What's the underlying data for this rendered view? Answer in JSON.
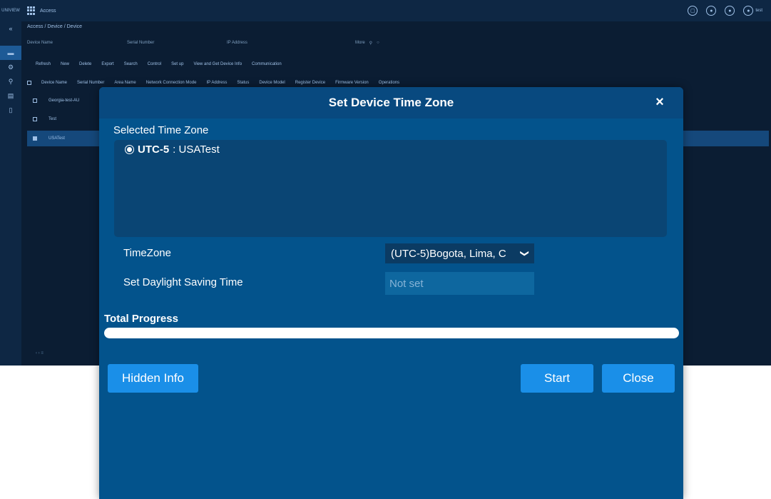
{
  "app": {
    "logo": "UNIVIEW",
    "module": "Access",
    "breadcrumb": "Access / Device / Device",
    "user": "test"
  },
  "filters": [
    "Device Name",
    "Serial Number",
    "IP Address"
  ],
  "more_label": "More",
  "toolbar": [
    "Refresh",
    "New",
    "Delete",
    "Export",
    "Search",
    "Control",
    "Set up",
    "View and Get Device Info",
    "Communication"
  ],
  "grid_headers": [
    "Device Name",
    "Serial Number",
    "Area Name",
    "Network Connection Mode",
    "IP Address",
    "Status",
    "Device Model",
    "Register Device",
    "Firmware Version",
    "Operations"
  ],
  "rows": [
    "Georgia-test-AU",
    "Test",
    "USATest"
  ],
  "modal": {
    "title": "Set Device Time Zone",
    "close_icon": "×",
    "selected_label": "Selected Time Zone",
    "selected_item_bold": "UTC-5",
    "selected_item_rest": " : USATest",
    "timezone_label": "TimeZone",
    "timezone_value": "(UTC-5)Bogota, Lima, C",
    "dst_label": "Set Daylight Saving Time",
    "dst_value": "Not set",
    "progress_label": "Total Progress",
    "progress_fraction": 0,
    "hidden_info": "Hidden Info",
    "start": "Start",
    "close": "Close"
  },
  "colors": {
    "modal_bg": "#03538c",
    "button": "#1a8fe8",
    "app_bg": "#0b1d33"
  }
}
